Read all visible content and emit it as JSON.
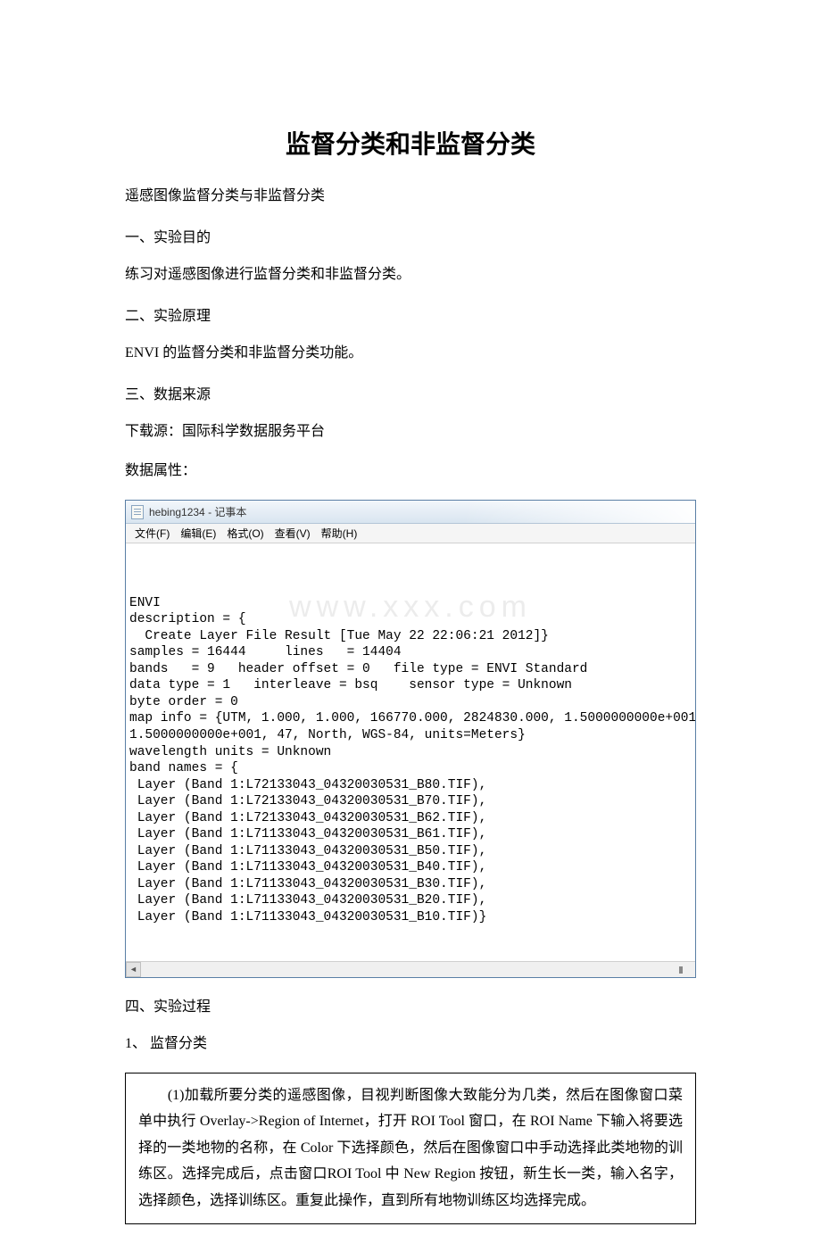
{
  "title": "监督分类和非监督分类",
  "paragraphs": {
    "p1": "遥感图像监督分类与非监督分类",
    "p2": "一、实验目的",
    "p3": "练习对遥感图像进行监督分类和非监督分类。",
    "p4": "二、实验原理",
    "p5": "ENVI 的监督分类和非监督分类功能。",
    "p6": "三、数据来源",
    "p7": "下载源：国际科学数据服务平台",
    "p8": "数据属性：",
    "p9": "四、实验过程",
    "p10": "1、 监督分类"
  },
  "notepad": {
    "title": "hebing1234 - 记事本",
    "menus": {
      "file": "文件(F)",
      "edit": "编辑(E)",
      "format": "格式(O)",
      "view": "查看(V)",
      "help": "帮助(H)"
    },
    "watermark": "www.xxx.com",
    "content": "ENVI\ndescription = {\n  Create Layer File Result [Tue May 22 22:06:21 2012]}\nsamples = 16444     lines   = 14404\nbands   = 9   header offset = 0   file type = ENVI Standard\ndata type = 1   interleave = bsq    sensor type = Unknown\nbyte order = 0\nmap info = {UTM, 1.000, 1.000, 166770.000, 2824830.000, 1.5000000000e+001,\n1.5000000000e+001, 47, North, WGS-84, units=Meters}\nwavelength units = Unknown\nband names = {\n Layer (Band 1:L72133043_04320030531_B80.TIF),\n Layer (Band 1:L72133043_04320030531_B70.TIF),\n Layer (Band 1:L72133043_04320030531_B62.TIF),\n Layer (Band 1:L71133043_04320030531_B61.TIF),\n Layer (Band 1:L71133043_04320030531_B50.TIF),\n Layer (Band 1:L71133043_04320030531_B40.TIF),\n Layer (Band 1:L71133043_04320030531_B30.TIF),\n Layer (Band 1:L71133043_04320030531_B20.TIF),\n Layer (Band 1:L71133043_04320030531_B10.TIF)}\n"
  },
  "boxed": {
    "text": "　　(1)加载所要分类的遥感图像，目视判断图像大致能分为几类，然后在图像窗口菜单中执行 Overlay->Region of Internet，打开 ROI Tool 窗口，在 ROI Name 下输入将要选择的一类地物的名称，在 Color 下选择颜色，然后在图像窗口中手动选择此类地物的训练区。选择完成后，点击窗口ROI Tool 中 New Region 按钮，新生长一类，输入名字，选择颜色，选择训练区。重复此操作，直到所有地物训练区均选择完成。"
  }
}
